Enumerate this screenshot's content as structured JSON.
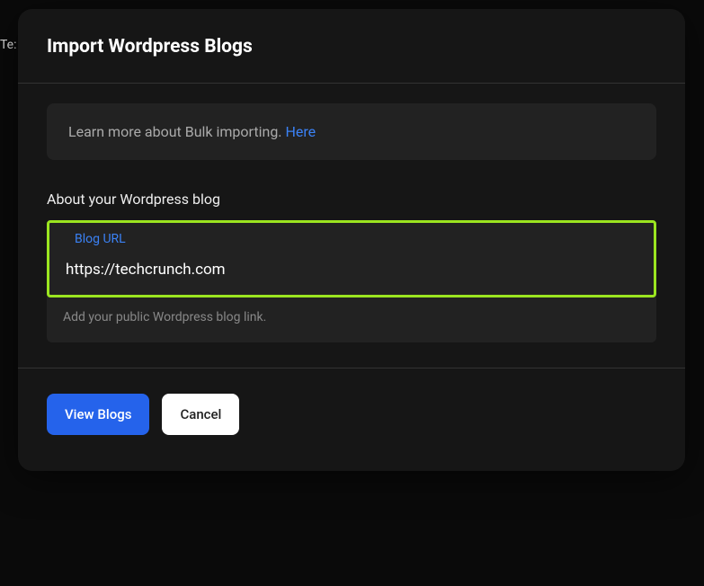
{
  "background": {
    "partial_text": "Te:"
  },
  "modal": {
    "title": "Import Wordpress Blogs",
    "info": {
      "text": "Learn more about Bulk importing. ",
      "link_label": "Here"
    },
    "section_label": "About your Wordpress blog",
    "input": {
      "label": "Blog URL",
      "value": "https://techcrunch.com",
      "placeholder": ""
    },
    "helper_text": "Add your public Wordpress blog link.",
    "buttons": {
      "primary": "View Blogs",
      "cancel": "Cancel"
    }
  }
}
